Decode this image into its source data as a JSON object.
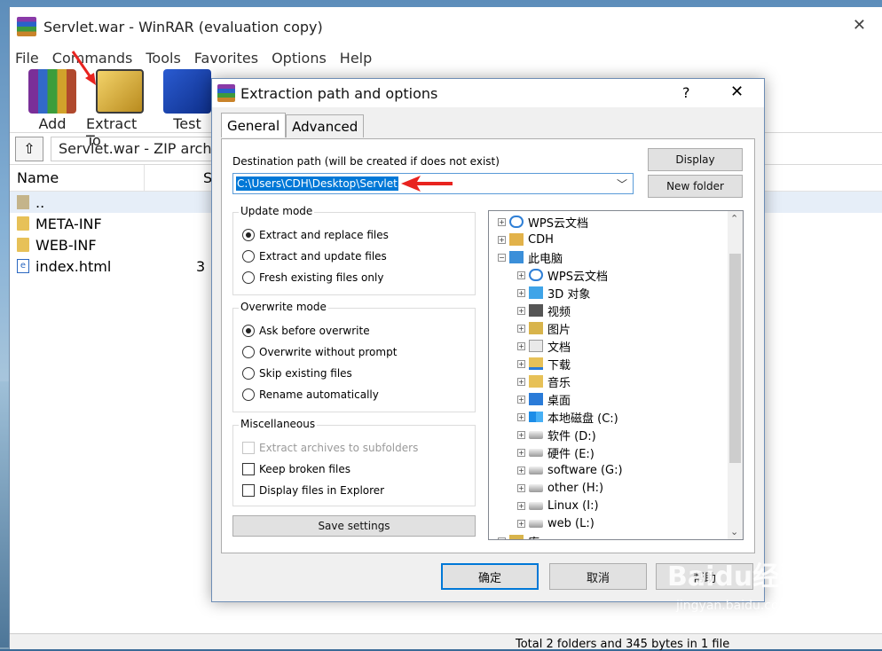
{
  "window": {
    "title": "Servlet.war - WinRAR (evaluation copy)",
    "close": "✕"
  },
  "menu": [
    "File",
    "Commands",
    "Tools",
    "Favorites",
    "Options",
    "Help"
  ],
  "toolbar": [
    {
      "label": "Add",
      "icon": "add-archive-icon"
    },
    {
      "label": "Extract To",
      "icon": "extract-to-icon"
    },
    {
      "label": "Test",
      "icon": "test-archive-icon"
    }
  ],
  "address": {
    "up": "⇧",
    "path": "Servlet.war - ZIP arch"
  },
  "filelist": {
    "header_name": "Name",
    "header_size": "S",
    "rows": [
      {
        "name": "..",
        "size": "",
        "icon": "parent-folder-icon"
      },
      {
        "name": "META-INF",
        "size": "",
        "icon": "folder-icon"
      },
      {
        "name": "WEB-INF",
        "size": "",
        "icon": "folder-icon"
      },
      {
        "name": "index.html",
        "size": "3",
        "icon": "html-file-icon"
      }
    ]
  },
  "status": {
    "text": "Total 2 folders and 345 bytes in 1 file"
  },
  "dialog": {
    "title": "Extraction path and options",
    "help": "?",
    "close": "✕",
    "tabs": [
      "General",
      "Advanced"
    ],
    "dest_label": "Destination path (will be created if does not exist)",
    "dest_value": "C:\\Users\\CDH\\Desktop\\Servlet",
    "display_btn": "Display",
    "new_folder_btn": "New folder",
    "update_mode": {
      "title": "Update mode",
      "options": [
        "Extract and replace files",
        "Extract and update files",
        "Fresh existing files only"
      ],
      "selected": 0
    },
    "overwrite_mode": {
      "title": "Overwrite mode",
      "options": [
        "Ask before overwrite",
        "Overwrite without prompt",
        "Skip existing files",
        "Rename automatically"
      ],
      "selected": 0
    },
    "misc": {
      "title": "Miscellaneous",
      "options": [
        "Extract archives to subfolders",
        "Keep broken files",
        "Display files in Explorer"
      ]
    },
    "save_settings": "Save settings",
    "tree": [
      {
        "label": "WPS云文档",
        "icon": "cloud-icon",
        "level": 0,
        "expander": "+"
      },
      {
        "label": "CDH",
        "icon": "user-folder-icon",
        "level": 0,
        "expander": "+"
      },
      {
        "label": "此电脑",
        "icon": "computer-icon",
        "level": 0,
        "expander": "−"
      },
      {
        "label": "WPS云文档",
        "icon": "cloud-icon",
        "level": 1,
        "expander": "+"
      },
      {
        "label": "3D 对象",
        "icon": "3d-objects-icon",
        "level": 1,
        "expander": "+"
      },
      {
        "label": "视频",
        "icon": "video-folder-icon",
        "level": 1,
        "expander": "+"
      },
      {
        "label": "图片",
        "icon": "pictures-folder-icon",
        "level": 1,
        "expander": "+"
      },
      {
        "label": "文档",
        "icon": "documents-folder-icon",
        "level": 1,
        "expander": "+"
      },
      {
        "label": "下载",
        "icon": "downloads-folder-icon",
        "level": 1,
        "expander": "+"
      },
      {
        "label": "音乐",
        "icon": "music-folder-icon",
        "level": 1,
        "expander": "+"
      },
      {
        "label": "桌面",
        "icon": "desktop-folder-icon",
        "level": 1,
        "expander": "+"
      },
      {
        "label": "本地磁盘 (C:)",
        "icon": "windows-drive-icon",
        "level": 1,
        "expander": "+"
      },
      {
        "label": "软件 (D:)",
        "icon": "drive-icon",
        "level": 1,
        "expander": "+"
      },
      {
        "label": "硬件 (E:)",
        "icon": "drive-icon",
        "level": 1,
        "expander": "+"
      },
      {
        "label": "software (G:)",
        "icon": "drive-icon",
        "level": 1,
        "expander": "+"
      },
      {
        "label": "other (H:)",
        "icon": "drive-icon",
        "level": 1,
        "expander": "+"
      },
      {
        "label": "Linux (I:)",
        "icon": "drive-icon",
        "level": 1,
        "expander": "+"
      },
      {
        "label": "web (L:)",
        "icon": "drive-icon",
        "level": 1,
        "expander": "+"
      },
      {
        "label": "库",
        "icon": "library-icon",
        "level": 0,
        "expander": "+"
      }
    ],
    "ok_btn": "确定",
    "cancel_btn": "取消",
    "help_btn": "帮助"
  },
  "watermark": {
    "brand": "Baidu经验",
    "url": "jingyan.baidu.com"
  },
  "colors": {
    "accent": "#0078d7",
    "annotation": "#e8231f"
  }
}
